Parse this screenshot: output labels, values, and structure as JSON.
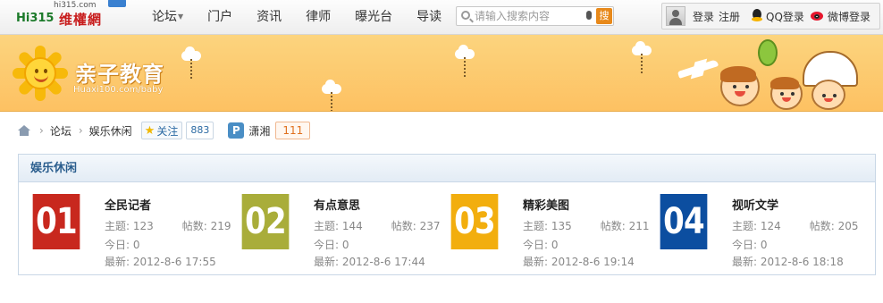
{
  "topbar": {
    "logo": {
      "domain": "hi315.com",
      "brand": "Hi315",
      "name": "维權網"
    },
    "nav": [
      {
        "label": "论坛",
        "has_caret": true
      },
      {
        "label": "门户"
      },
      {
        "label": "资讯"
      },
      {
        "label": "律师"
      },
      {
        "label": "曝光台"
      },
      {
        "label": "导读"
      }
    ],
    "search": {
      "placeholder": "请输入搜索内容",
      "button_label": "搜"
    },
    "user": {
      "login": "登录",
      "register": "注册",
      "qq_login": "QQ登录",
      "weibo_login": "微博登录"
    }
  },
  "banner": {
    "title": "亲子教育",
    "subtitle": "Huaxi100.com/baby"
  },
  "breadcrumb": {
    "items": [
      "论坛",
      "娱乐休闲"
    ],
    "follow_label": "关注",
    "follow_count": "883",
    "moderator_icon": "P",
    "moderator": "潇湘",
    "moderator_count": "111"
  },
  "section": {
    "title": "娱乐休闲",
    "forums": [
      {
        "number": "01",
        "color": "#c8281e",
        "name": "全民记者",
        "topics_label": "主题:",
        "topics": "123",
        "posts_label": "帖数:",
        "posts": "219",
        "today_label": "今日:",
        "today": "0",
        "latest_label": "最新:",
        "latest": "2012-8-6 17:55"
      },
      {
        "number": "02",
        "color": "#a9ad3a",
        "name": "有点意思",
        "topics_label": "主题:",
        "topics": "144",
        "posts_label": "帖数:",
        "posts": "237",
        "today_label": "今日:",
        "today": "0",
        "latest_label": "最新:",
        "latest": "2012-8-6 17:44"
      },
      {
        "number": "03",
        "color": "#f2ae0e",
        "name": "精彩美图",
        "topics_label": "主题:",
        "topics": "135",
        "posts_label": "帖数:",
        "posts": "211",
        "today_label": "今日:",
        "today": "0",
        "latest_label": "最新:",
        "latest": "2012-8-6 19:14"
      },
      {
        "number": "04",
        "color": "#0c4ea0",
        "name": "视听文学",
        "topics_label": "主题:",
        "topics": "124",
        "posts_label": "帖数:",
        "posts": "205",
        "today_label": "今日:",
        "today": "0",
        "latest_label": "最新:",
        "latest": "2012-8-6 18:18"
      }
    ]
  }
}
